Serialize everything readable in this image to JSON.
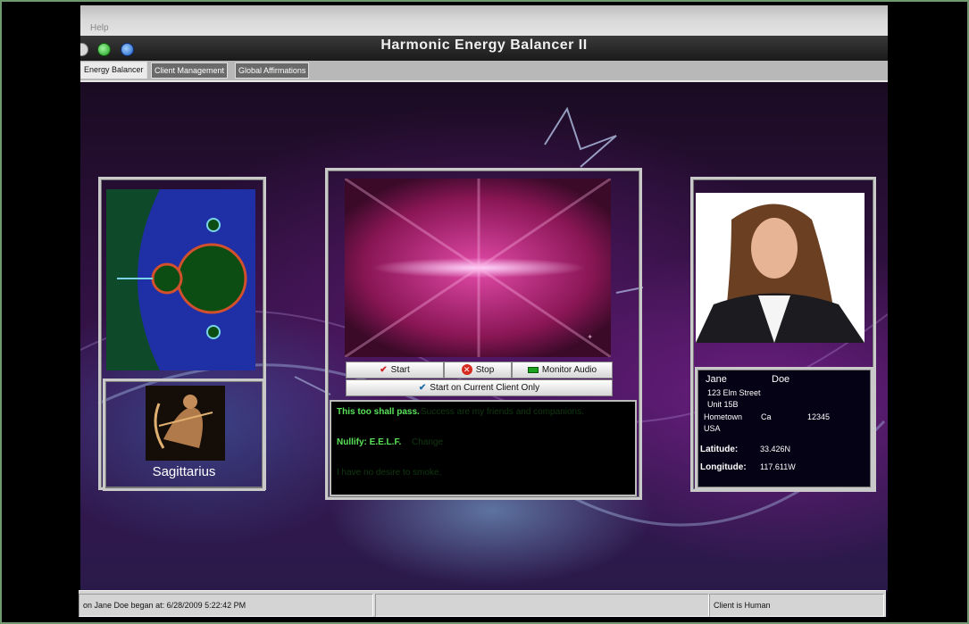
{
  "app": {
    "title": "Harmonic Energy Balancer II"
  },
  "menu": {
    "help": "Help"
  },
  "tabs": [
    {
      "label": "Energy Balancer",
      "active": true
    },
    {
      "label": "Client Management",
      "active": false
    },
    {
      "label": "Global Affirmations",
      "active": false
    }
  ],
  "zodiac": {
    "sign": "Sagittarius"
  },
  "controls": {
    "start": "Start",
    "stop": "Stop",
    "monitor": "Monitor Audio",
    "start_current": "Start on Current Client Only"
  },
  "affirmations": [
    {
      "text": "This too shall pass.",
      "ghost": "Success are my friends and companions."
    },
    {
      "text": "Nullify: E.E.L.F.",
      "ghost": "Change"
    },
    {
      "text": "",
      "ghost": "I have no desire to smoke."
    }
  ],
  "client": {
    "first_name": "Jane",
    "last_name": "Doe",
    "address1": "123 Elm Street",
    "address2": "Unit 15B",
    "city": "Hometown",
    "state": "Ca",
    "zip": "12345",
    "country": "USA",
    "latitude_label": "Latitude:",
    "latitude": "33.426N",
    "longitude_label": "Longitude:",
    "longitude": "117.611W"
  },
  "status": {
    "session": "on Jane Doe began at: 6/28/2009 5:22:42 PM",
    "middle": "",
    "client_state": "Client is Human"
  },
  "colors": {
    "affirmation_green": "#59e359",
    "panel_border": "#c9c9c9",
    "title_bar": "#1a1a1a",
    "stop_red": "#d42b1e",
    "check_red": "#cc2222"
  },
  "icons": {
    "start": "check-icon",
    "stop": "stop-x-icon",
    "monitor": "audio-meter-icon",
    "start_current": "check-icon"
  }
}
